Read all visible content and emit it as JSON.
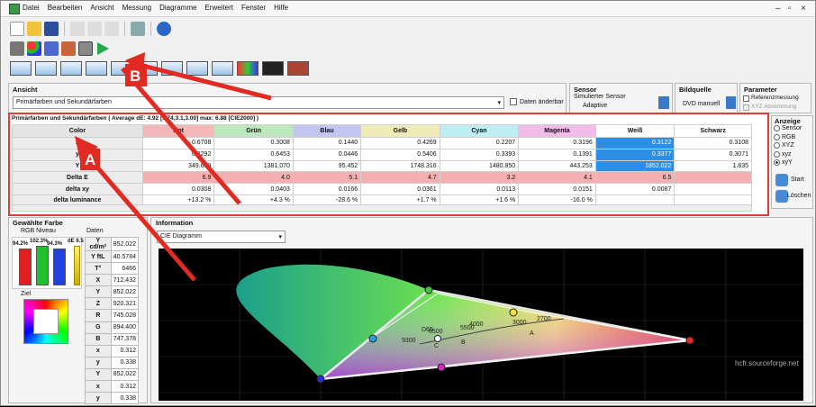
{
  "menu": [
    "Datei",
    "Bearbeiten",
    "Ansicht",
    "Messung",
    "Diagramme",
    "Erweitert",
    "Fenster",
    "Hilfe"
  ],
  "ansicht": {
    "title": "Ansicht",
    "selection": "Primärfarben und Sekundärfarben",
    "checkbox_label": "Daten änderbar"
  },
  "sensor": {
    "title": "Sensor",
    "line1": "Simulierter Sensor",
    "line2": "Adaptive"
  },
  "bildquelle": {
    "title": "Bildquelle",
    "value": "DVD manuell"
  },
  "parameter": {
    "title": "Parameter",
    "opt1": "Referenzmessung",
    "opt2": "XYZ Abstimmung"
  },
  "anzeige": {
    "title": "Anzeige",
    "options": [
      "Sensor",
      "RGB",
      "XYZ",
      "xyz",
      "xyY"
    ],
    "selected": "xyY",
    "start": "Start",
    "loeschen": "Löschen"
  },
  "measure": {
    "caption": "Primärfarben und Sekundärfarben ( Average dE: 4.92 [1.74,3.1,3.00] max: 6.88 [CIE2000] )",
    "columns": [
      "Color",
      "Rot",
      "Grün",
      "Blau",
      "Gelb",
      "Cyan",
      "Magenta",
      "Weiß",
      "Schwarz"
    ],
    "header_colors": [
      "#e4e4e4",
      "#f4b8b8",
      "#bde8be",
      "#c3c6ee",
      "#f0ecb8",
      "#bdeef4",
      "#f2bce8",
      "#ffffff",
      "#ffffff"
    ],
    "rows": [
      {
        "label": "x",
        "values": [
          "0.6708",
          "0.3008",
          "0.1440",
          "0.4269",
          "0.2207",
          "0.3196",
          "0.3122",
          "0.3108"
        ]
      },
      {
        "label": "y",
        "values": [
          "0.3292",
          "0.6453",
          "0.0446",
          "0.5406",
          "0.3393",
          "0.1391",
          "0.3377",
          "0.3071"
        ]
      },
      {
        "label": "Y",
        "values": [
          "349.659",
          "1381.070",
          "95.452",
          "1748.316",
          "1480.850",
          "443.253",
          "1852.022",
          "1.835"
        ]
      },
      {
        "label": "Delta E",
        "values": [
          "6.9",
          "4.0",
          "5.1",
          "4.7",
          "3.2",
          "4.1",
          "6.5",
          ""
        ]
      },
      {
        "label": "delta xy",
        "values": [
          "0.0308",
          "0.0403",
          "0.0166",
          "0.0361",
          "0.0113",
          "0.0151",
          "0.0087",
          ""
        ]
      },
      {
        "label": "delta luminance",
        "values": [
          "+13.2 %",
          "+4.3 %",
          "-28.6 %",
          "+1.7 %",
          "+1.6 %",
          "-16.0 %",
          "",
          ""
        ]
      }
    ]
  },
  "gewaehlte": {
    "title": "Gewählte Farbe",
    "rgb_title": "RGB Niveau",
    "daten_title": "Daten",
    "bars": [
      {
        "label": "94.2%",
        "color": "#e02020",
        "level": 0.94
      },
      {
        "label": "102.3%",
        "color": "#20c030",
        "level": 1.0
      },
      {
        "label": "94.3%",
        "color": "#2040e0",
        "level": 0.94
      }
    ],
    "de_label": "dE 6.5",
    "ziel": "Ziel",
    "rows": [
      {
        "k": "Y cd/m²",
        "v": "852.022"
      },
      {
        "k": "Y ftL",
        "v": "40.5784"
      },
      {
        "k": "T°",
        "v": "6466"
      },
      {
        "k": "X",
        "v": "712.432"
      },
      {
        "k": "Y",
        "v": "852.022"
      },
      {
        "k": "Z",
        "v": "920.321"
      },
      {
        "k": "R",
        "v": "745.028"
      },
      {
        "k": "G",
        "v": "894.400"
      },
      {
        "k": "B",
        "v": "747.378"
      },
      {
        "k": "x",
        "v": "0.312"
      },
      {
        "k": "y",
        "v": "0.338"
      },
      {
        "k": "Y",
        "v": "852.022"
      },
      {
        "k": "x",
        "v": "0.312"
      },
      {
        "k": "y",
        "v": "0.338"
      }
    ]
  },
  "information": {
    "title": "Information",
    "select": "CIE Diagramm",
    "watermark": "hcfr.sourceforge.net",
    "cct": [
      "9300",
      "6500",
      "5500",
      "4000",
      "3000",
      "2700"
    ],
    "illuminants": [
      "D65",
      "C",
      "B",
      "A"
    ]
  },
  "annotations": {
    "a": "A",
    "b": "B"
  }
}
